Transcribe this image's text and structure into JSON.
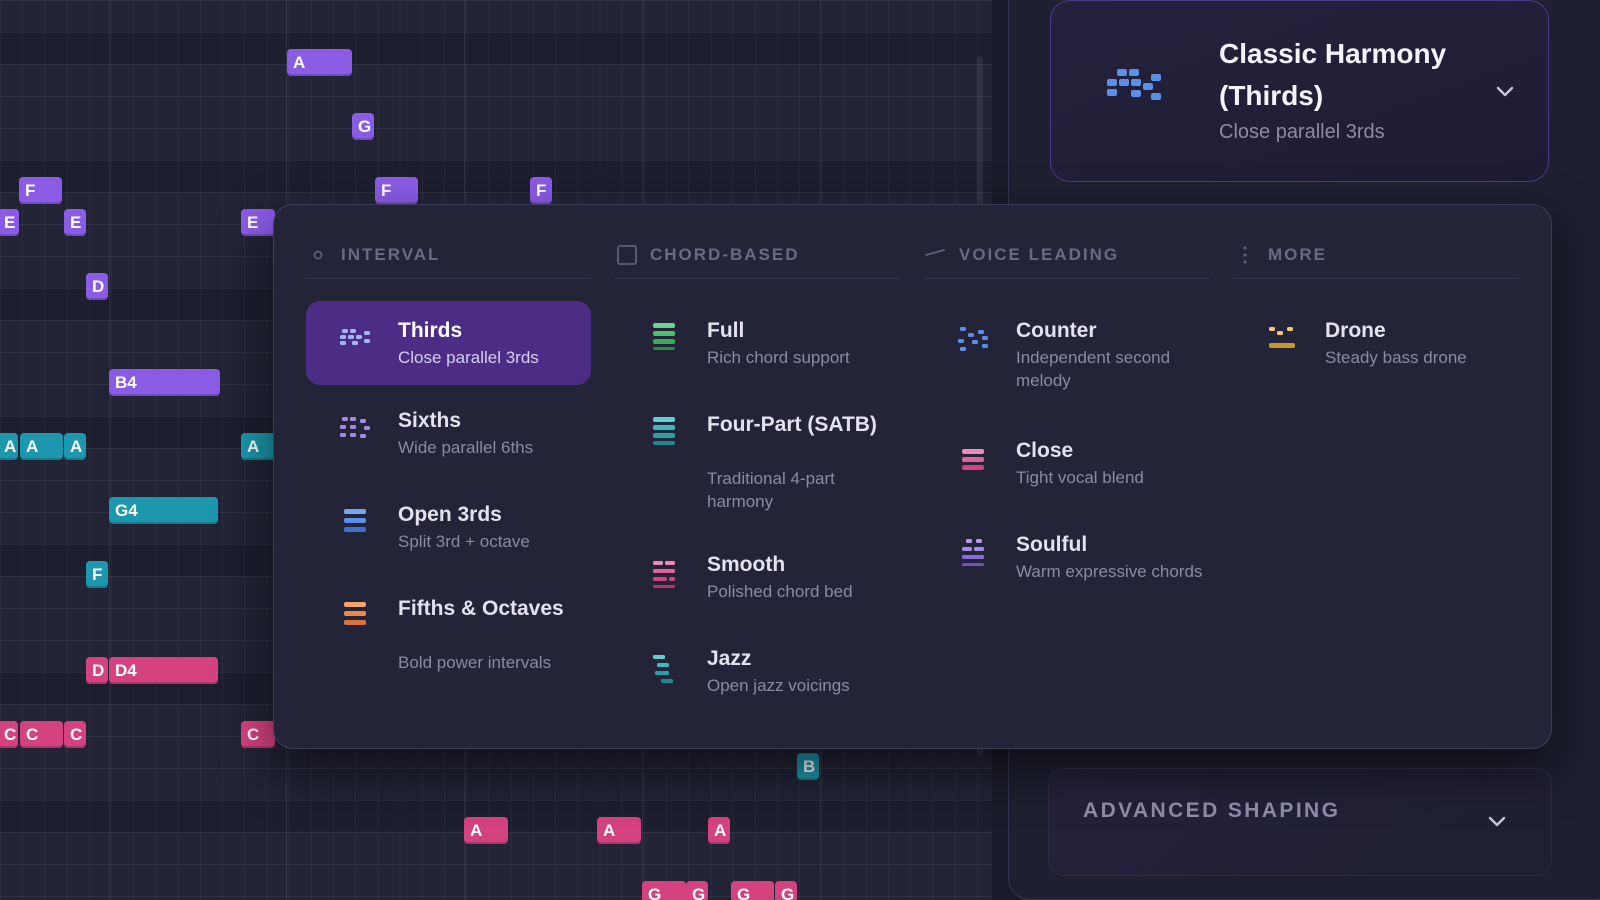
{
  "piano_roll": {
    "notes": [
      {
        "label": "A",
        "color": "purple"
      },
      {
        "label": "G",
        "color": "purple"
      },
      {
        "label": "F",
        "color": "purple"
      },
      {
        "label": "F",
        "color": "purple"
      },
      {
        "label": "F",
        "color": "purple"
      },
      {
        "label": "E",
        "color": "purple"
      },
      {
        "label": "E",
        "color": "purple"
      },
      {
        "label": "E",
        "color": "purple"
      },
      {
        "label": "D",
        "color": "purple"
      },
      {
        "label": "B4",
        "color": "purple"
      },
      {
        "label": "A",
        "color": "teal"
      },
      {
        "label": "A",
        "color": "teal"
      },
      {
        "label": "A",
        "color": "teal"
      },
      {
        "label": "A",
        "color": "teal"
      },
      {
        "label": "G4",
        "color": "teal"
      },
      {
        "label": "F",
        "color": "teal"
      },
      {
        "label": "B",
        "color": "teal"
      },
      {
        "label": "D",
        "color": "pink"
      },
      {
        "label": "D4",
        "color": "pink"
      },
      {
        "label": "C",
        "color": "pink"
      },
      {
        "label": "C",
        "color": "pink"
      },
      {
        "label": "C",
        "color": "pink"
      },
      {
        "label": "C",
        "color": "pink"
      },
      {
        "label": "A",
        "color": "pink"
      },
      {
        "label": "A",
        "color": "pink"
      },
      {
        "label": "A",
        "color": "pink"
      },
      {
        "label": "G",
        "color": "pink"
      },
      {
        "label": "G",
        "color": "pink"
      },
      {
        "label": "G",
        "color": "pink"
      },
      {
        "label": "G",
        "color": "pink"
      }
    ],
    "colors": {
      "purple": "#8a5ce6",
      "teal": "#1c97ad",
      "pink": "#d4427f"
    }
  },
  "preset": {
    "title": "Classic Harmony (Thirds)",
    "subtitle": "Close parallel 3rds",
    "icon": "harmony-dots-icon"
  },
  "advanced": {
    "label": "ADVANCED SHAPING"
  },
  "dropdown": {
    "columns": [
      {
        "heading": "INTERVAL",
        "icon": "circle-icon",
        "options": [
          {
            "title": "Thirds",
            "subtitle": "Close parallel 3rds",
            "selected": true,
            "icon": "thirds-icon"
          },
          {
            "title": "Sixths",
            "subtitle": "Wide parallel 6ths",
            "icon": "sixths-icon"
          },
          {
            "title": "Open 3rds",
            "subtitle": "Split 3rd + octave",
            "icon": "open-thirds-icon"
          },
          {
            "title": "Fifths & Octaves",
            "subtitle": "Bold power intervals",
            "icon": "fifths-icon"
          }
        ]
      },
      {
        "heading": "CHORD-BASED",
        "icon": "square-icon",
        "options": [
          {
            "title": "Full",
            "subtitle": "Rich chord support",
            "icon": "full-chord-icon"
          },
          {
            "title": "Four-Part (SATB)",
            "subtitle": "Traditional 4-part harmony",
            "icon": "satb-icon"
          },
          {
            "title": "Smooth",
            "subtitle": "Polished chord bed",
            "icon": "smooth-icon"
          },
          {
            "title": "Jazz",
            "subtitle": "Open jazz voicings",
            "icon": "jazz-icon"
          }
        ]
      },
      {
        "heading": "VOICE LEADING",
        "icon": "slash-icon",
        "options": [
          {
            "title": "Counter",
            "subtitle": "Independent second melody",
            "icon": "counter-icon"
          },
          {
            "title": "Close",
            "subtitle": "Tight vocal blend",
            "icon": "close-icon"
          },
          {
            "title": "Soulful",
            "subtitle": "Warm expressive chords",
            "icon": "soulful-icon"
          }
        ]
      },
      {
        "heading": "MORE",
        "icon": "vertical-dots-icon",
        "options": [
          {
            "title": "Drone",
            "subtitle": "Steady bass drone",
            "icon": "drone-icon"
          }
        ]
      }
    ]
  }
}
